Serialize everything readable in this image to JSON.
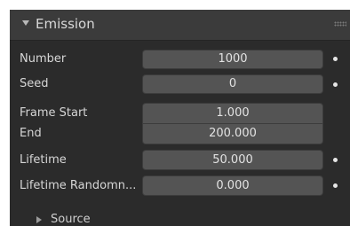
{
  "panel": {
    "title": "Emission",
    "expanded": true,
    "rows": [
      {
        "label": "Number",
        "value": "1000",
        "animatable": true
      },
      {
        "label": "Seed",
        "value": "0",
        "animatable": true
      },
      {
        "label": "Frame Start",
        "value": "1.000",
        "animatable": false
      },
      {
        "label": "End",
        "value": "200.000",
        "animatable": false
      },
      {
        "label": "Lifetime",
        "value": "50.000",
        "animatable": true
      },
      {
        "label": "Lifetime Randomn...",
        "value": "0.000",
        "animatable": true
      }
    ],
    "subpanel": {
      "label": "Source",
      "expanded": false
    }
  },
  "colors": {
    "panel_bg": "#2b2b2b",
    "header_bg": "#3b3b3b",
    "field_bg": "#545454",
    "text": "#dddddd"
  },
  "icons": {
    "header_toggle": "disclosure-triangle-down-icon",
    "subpanel_toggle": "disclosure-triangle-right-icon",
    "drag": "grip-icon",
    "keyframe": "keyframe-dot-icon"
  }
}
